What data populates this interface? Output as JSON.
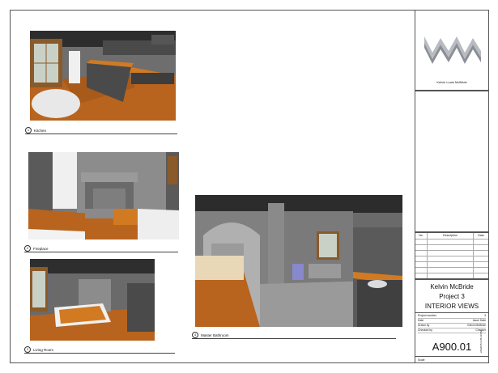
{
  "views": [
    {
      "number": "1",
      "title": "Kitchen"
    },
    {
      "number": "2",
      "title": "Fireplace"
    },
    {
      "number": "3",
      "title": "Living Room"
    },
    {
      "number": "4",
      "title": "Master Bathroom"
    }
  ],
  "title_block": {
    "logo_caption": "Kelvin Louis McBride",
    "revision_headers": {
      "no": "No.",
      "description": "Description",
      "date": "Date"
    },
    "owner": "Kelvin McBride",
    "project": "Project 3",
    "sheet_name": "INTERIOR VIEWS",
    "info": [
      {
        "label": "Project number",
        "value": "3"
      },
      {
        "label": "Date",
        "value": "Issue Date"
      },
      {
        "label": "Drawn by",
        "value": "Kelvin McBride"
      },
      {
        "label": "Checked by",
        "value": "Checker"
      }
    ],
    "sheet_number": "A900.01",
    "scale_label": "Scale",
    "timestamp": "2/2/2015 9:35:29 PM"
  },
  "colors": {
    "wood_floor": "#b8641e",
    "counter": "#d27a22",
    "wall_dark": "#3a3a3a",
    "wall_gray": "#7d7d7d"
  }
}
